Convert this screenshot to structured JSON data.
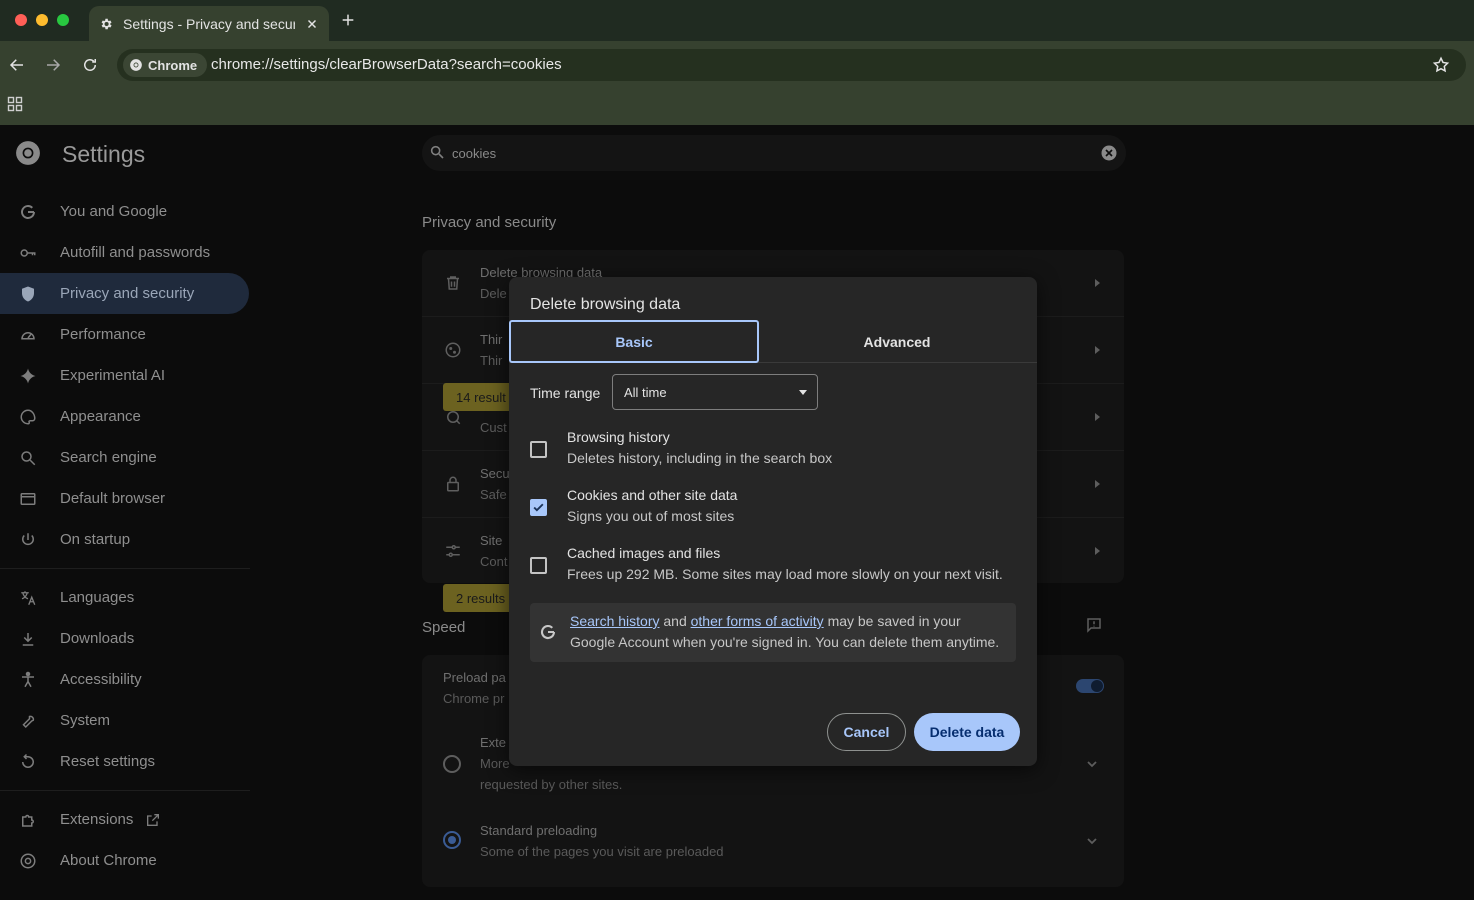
{
  "browser": {
    "tab_title": "Settings - Privacy and securi",
    "chip_label": "Chrome",
    "url": "chrome://settings/clearBrowserData?search=cookies"
  },
  "settings": {
    "title": "Settings",
    "search_value": "cookies",
    "sidebar": {
      "items": [
        {
          "label": "You and Google",
          "icon": "google-icon"
        },
        {
          "label": "Autofill and passwords",
          "icon": "key-icon"
        },
        {
          "label": "Privacy and security",
          "icon": "shield-icon",
          "active": true
        },
        {
          "label": "Performance",
          "icon": "speedometer-icon"
        },
        {
          "label": "Experimental AI",
          "icon": "sparkle-icon"
        },
        {
          "label": "Appearance",
          "icon": "palette-icon"
        },
        {
          "label": "Search engine",
          "icon": "search-icon"
        },
        {
          "label": "Default browser",
          "icon": "browser-window-icon"
        },
        {
          "label": "On startup",
          "icon": "power-icon"
        }
      ],
      "items2": [
        {
          "label": "Languages",
          "icon": "translate-icon"
        },
        {
          "label": "Downloads",
          "icon": "download-icon"
        },
        {
          "label": "Accessibility",
          "icon": "accessibility-icon"
        },
        {
          "label": "System",
          "icon": "wrench-icon"
        },
        {
          "label": "Reset settings",
          "icon": "reset-icon"
        }
      ],
      "items3": [
        {
          "label": "Extensions",
          "icon": "puzzle-icon"
        },
        {
          "label": "About Chrome",
          "icon": "chrome-icon"
        }
      ]
    },
    "privacy_section_title": "Privacy and security",
    "privacy_rows": [
      {
        "t1": "Delete browsing data",
        "t2": "Dele",
        "icon": "trash-icon"
      },
      {
        "t1": "Thir",
        "t2": "Thir",
        "icon": "cookie-icon"
      },
      {
        "t1": "",
        "t2": "Cust",
        "icon": "privacy-sandbox-icon"
      },
      {
        "t1": "Secu",
        "t2": "Safe",
        "icon": "lock-icon"
      },
      {
        "t1": "Site",
        "t2": "Cont",
        "icon": "sliders-icon"
      }
    ],
    "badge1": "14 result",
    "badge2": "2 results",
    "speed_section_title": "Speed",
    "speed": {
      "preload_t1": "Preload pa",
      "preload_t2": "Chrome pr",
      "ext_t1": "Exte",
      "ext_t2": "More",
      "ext_t3": "requested by other sites.",
      "std_t1": "Standard preloading",
      "std_t2": "Some of the pages you visit are preloaded"
    }
  },
  "dialog": {
    "title": "Delete browsing data",
    "tab_basic": "Basic",
    "tab_advanced": "Advanced",
    "time_range_label": "Time range",
    "time_range_value": "All time",
    "options": [
      {
        "title": "Browsing history",
        "desc": "Deletes history, including in the search box",
        "checked": false
      },
      {
        "title": "Cookies and other site data",
        "desc": "Signs you out of most sites",
        "checked": true
      },
      {
        "title": "Cached images and files",
        "desc": "Frees up 292 MB. Some sites may load more slowly on your next visit.",
        "checked": false
      }
    ],
    "info": {
      "link1": "Search history",
      "and": "and",
      "link2": "other forms of activity",
      "line1_rest": "may be saved in your",
      "line2": "Google Account when you're signed in. You can delete them anytime."
    },
    "cancel_label": "Cancel",
    "delete_label": "Delete data"
  },
  "colors": {
    "accent": "#a8c7fa",
    "dialog_bg": "#262626",
    "page_bg": "#0c0c0c"
  }
}
